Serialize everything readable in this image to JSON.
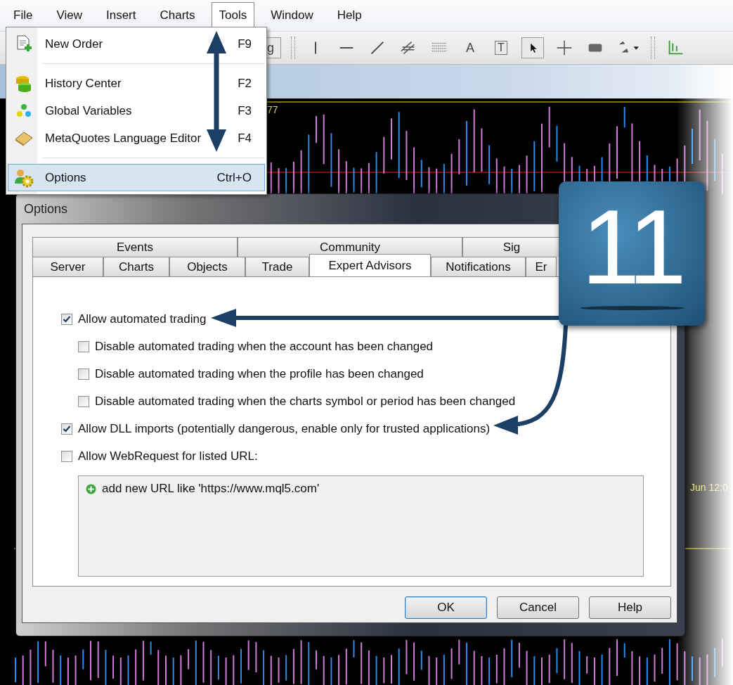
{
  "menu_bar": {
    "items": [
      {
        "label": "File",
        "selected": false
      },
      {
        "label": "View",
        "selected": false
      },
      {
        "label": "Insert",
        "selected": false
      },
      {
        "label": "Charts",
        "selected": false
      },
      {
        "label": "Tools",
        "selected": true
      },
      {
        "label": "Window",
        "selected": false
      },
      {
        "label": "Help",
        "selected": false
      }
    ]
  },
  "toolbar": {
    "partial_button": "g",
    "text_tool": "A",
    "text_label_tool": "T"
  },
  "chart": {
    "price_label": "77",
    "time_label": "Jun 12:0"
  },
  "tools_menu": {
    "items": [
      {
        "kind": "item",
        "label": "New Order",
        "shortcut": "F9",
        "selected": false
      },
      {
        "kind": "separator"
      },
      {
        "kind": "item",
        "label": "History Center",
        "shortcut": "F2",
        "selected": false
      },
      {
        "kind": "item",
        "label": "Global Variables",
        "shortcut": "F3",
        "selected": false
      },
      {
        "kind": "item",
        "label": "MetaQuotes Language Editor",
        "shortcut": "F4",
        "selected": false
      },
      {
        "kind": "separator"
      },
      {
        "kind": "item",
        "label": "Options",
        "shortcut": "Ctrl+O",
        "selected": true
      }
    ]
  },
  "dialog": {
    "title": "Options",
    "tab_rows": [
      [
        {
          "label": "Events",
          "selected": false
        },
        {
          "label": "Community",
          "selected": false
        },
        {
          "label": "Sig",
          "selected": false
        }
      ],
      [
        {
          "label": "Server",
          "selected": false
        },
        {
          "label": "Charts",
          "selected": false
        },
        {
          "label": "Objects",
          "selected": false
        },
        {
          "label": "Trade",
          "selected": false
        },
        {
          "label": "Expert Advisors",
          "selected": true
        },
        {
          "label": "Notifications",
          "selected": false
        },
        {
          "label": "Er",
          "selected": false
        }
      ]
    ],
    "options": [
      {
        "label": "Allow automated trading",
        "checked": true,
        "children": [
          {
            "label": "Disable automated trading when the account has been changed",
            "checked": false
          },
          {
            "label": "Disable automated trading when the profile has been changed",
            "checked": false
          },
          {
            "label": "Disable automated trading when the charts symbol or period has been changed",
            "checked": false
          }
        ]
      },
      {
        "label": "Allow DLL imports (potentially dangerous, enable only for trusted applications)",
        "checked": true
      },
      {
        "label": "Allow WebRequest for listed URL:",
        "checked": false
      }
    ],
    "url_list": {
      "items": [
        "add new URL like 'https://www.mql5.com'"
      ]
    },
    "buttons": [
      {
        "label": "OK",
        "default": true
      },
      {
        "label": "Cancel",
        "default": false
      },
      {
        "label": "Help",
        "default": false
      }
    ]
  },
  "badge": {
    "text": "11"
  }
}
